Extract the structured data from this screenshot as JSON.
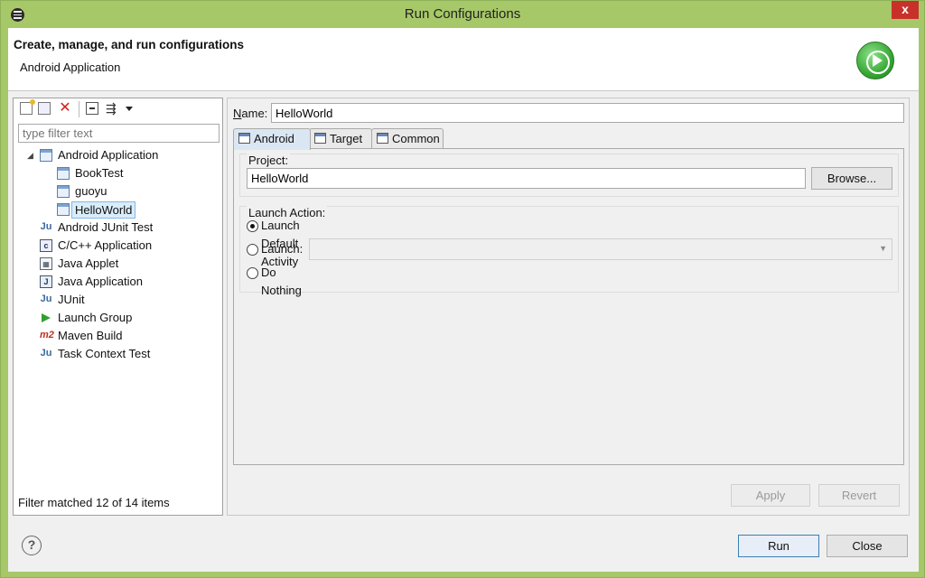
{
  "window": {
    "title": "Run Configurations",
    "menu_icon": "window-menu-icon",
    "close_glyph": "x"
  },
  "header": {
    "title": "Create, manage, and run configurations",
    "subtitle": "Android Application",
    "icon": "run-icon"
  },
  "left_panel": {
    "toolbar": [
      "new-config-icon",
      "duplicate-config-icon",
      "delete-config-icon",
      "collapse-all-icon",
      "filter-config-icon",
      "view-menu-icon"
    ],
    "filter_placeholder": "type filter text",
    "tree": [
      {
        "label": "Android Application",
        "icon": "android-application-icon",
        "expanded": true,
        "level": 0
      },
      {
        "label": "BookTest",
        "icon": "android-application-icon",
        "level": 1
      },
      {
        "label": "guoyu",
        "icon": "android-application-icon",
        "level": 1
      },
      {
        "label": "HelloWorld",
        "icon": "android-application-icon",
        "level": 1,
        "selected": true
      },
      {
        "label": "Android JUnit Test",
        "icon": "android-junit-icon",
        "level": 0
      },
      {
        "label": "C/C++ Application",
        "icon": "cpp-application-icon",
        "level": 0
      },
      {
        "label": "Java Applet",
        "icon": "java-applet-icon",
        "level": 0
      },
      {
        "label": "Java Application",
        "icon": "java-application-icon",
        "level": 0
      },
      {
        "label": "JUnit",
        "icon": "junit-icon",
        "level": 0
      },
      {
        "label": "Launch Group",
        "icon": "launch-group-icon",
        "level": 0
      },
      {
        "label": "Maven Build",
        "icon": "maven-icon",
        "level": 0
      },
      {
        "label": "Task Context Test",
        "icon": "task-context-icon",
        "level": 0
      }
    ],
    "status": "Filter matched 12 of 14 items"
  },
  "right_panel": {
    "name_label": "Name:",
    "name_value": "HelloWorld",
    "tabs": [
      {
        "label": "Android",
        "active": true
      },
      {
        "label": "Target",
        "active": false
      },
      {
        "label": "Common",
        "active": false
      }
    ],
    "project": {
      "group_label": "Project:",
      "value": "HelloWorld",
      "browse_label": "Browse..."
    },
    "launch_action": {
      "group_label": "Launch Action:",
      "options": [
        {
          "label": "Launch Default Activity",
          "checked": true
        },
        {
          "label": "Launch:",
          "checked": false
        },
        {
          "label": "Do Nothing",
          "checked": false
        }
      ],
      "launch_select_value": ""
    },
    "apply_label": "Apply",
    "revert_label": "Revert"
  },
  "footer": {
    "help_glyph": "?",
    "run_label": "Run",
    "close_label": "Close"
  }
}
